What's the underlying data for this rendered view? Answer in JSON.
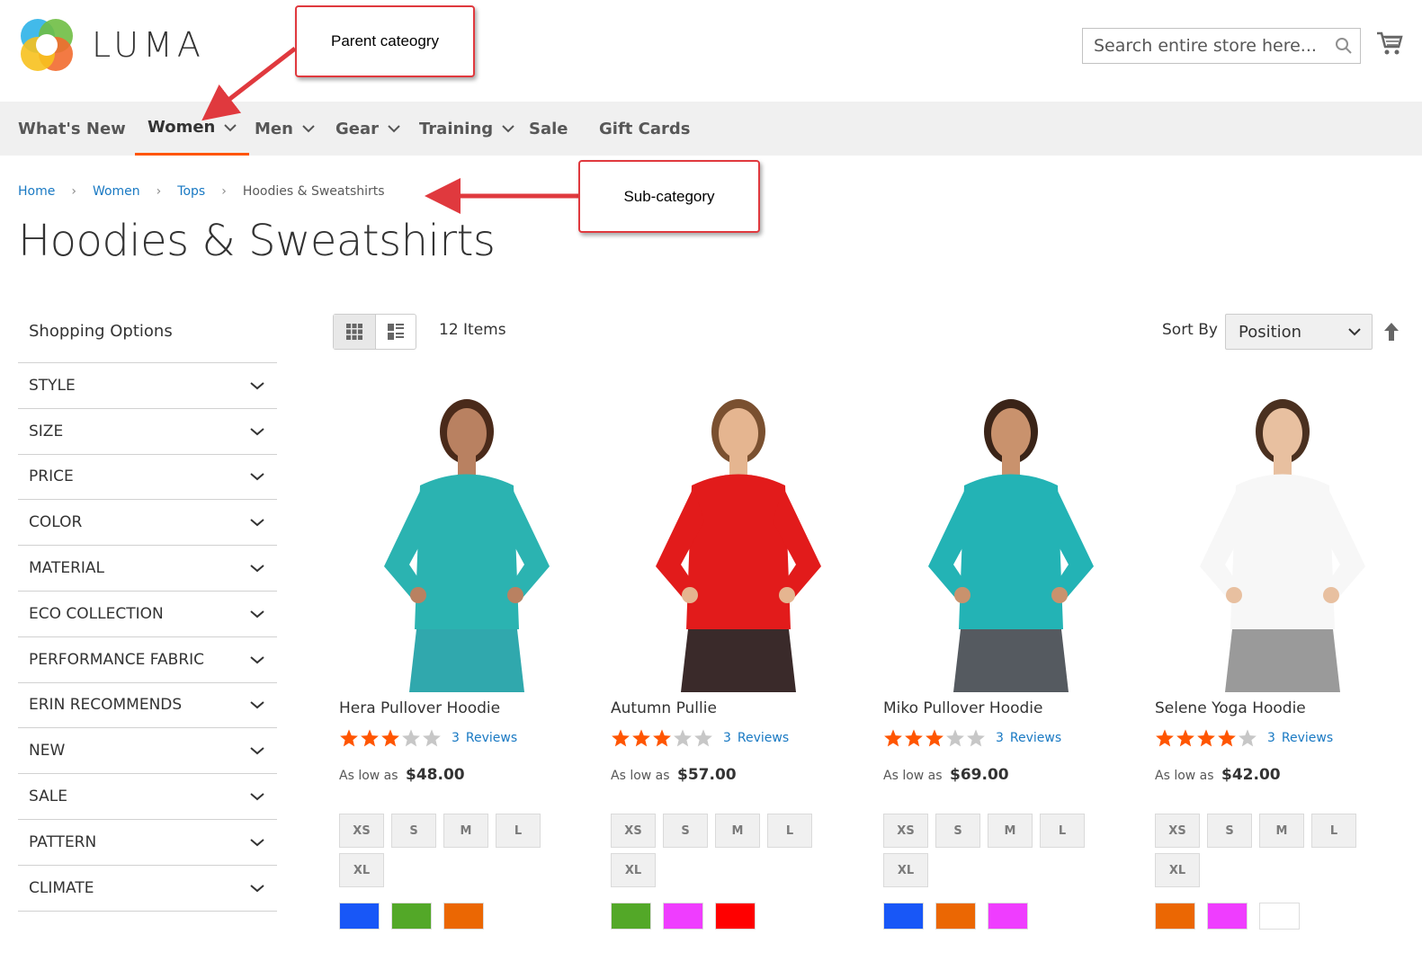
{
  "header": {
    "logo_text": "LUMA",
    "search_placeholder": "Search entire store here...",
    "icons": [
      "search-icon",
      "cart-icon"
    ]
  },
  "nav": {
    "items": [
      {
        "label": "What's New"
      },
      {
        "label": "Women"
      },
      {
        "label": "Men"
      },
      {
        "label": "Gear"
      },
      {
        "label": "Training"
      },
      {
        "label": "Sale"
      },
      {
        "label": "Gift Cards"
      }
    ],
    "active": "Women"
  },
  "breadcrumb": [
    "Home",
    "Women",
    "Tops",
    "Hoodies & Sweatshirts"
  ],
  "page_title": "Hoodies & Sweatshirts",
  "annotations": {
    "parent": "Parent cateogry",
    "sub": "Sub-category"
  },
  "sidebar": {
    "title": "Shopping Options",
    "filters": [
      "STYLE",
      "SIZE",
      "PRICE",
      "COLOR",
      "MATERIAL",
      "ECO COLLECTION",
      "PERFORMANCE FABRIC",
      "ERIN RECOMMENDS",
      "NEW",
      "SALE",
      "PATTERN",
      "CLIMATE"
    ]
  },
  "toolbar": {
    "item_count": "12 Items",
    "sort_label": "Sort By",
    "sort_value": "Position"
  },
  "products": [
    {
      "name": "Hera Pullover Hoodie",
      "rating": 3,
      "review_count": "3",
      "review_label": "Reviews",
      "price_prefix": "As low as",
      "price": "$48.00",
      "sizes": [
        "XS",
        "S",
        "M",
        "L",
        "XL"
      ],
      "colors": [
        "#1857f7",
        "#53a828",
        "#eb6703"
      ]
    },
    {
      "name": "Autumn Pullie",
      "rating": 3,
      "review_count": "3",
      "review_label": "Reviews",
      "price_prefix": "As low as",
      "price": "$57.00",
      "sizes": [
        "XS",
        "S",
        "M",
        "L",
        "XL"
      ],
      "colors": [
        "#53a828",
        "#ef3dff",
        "#ff0000"
      ]
    },
    {
      "name": "Miko Pullover Hoodie",
      "rating": 3,
      "review_count": "3",
      "review_label": "Reviews",
      "price_prefix": "As low as",
      "price": "$69.00",
      "sizes": [
        "XS",
        "S",
        "M",
        "L",
        "XL"
      ],
      "colors": [
        "#1857f7",
        "#eb6703",
        "#ef3dff"
      ]
    },
    {
      "name": "Selene Yoga Hoodie",
      "rating": 4,
      "review_count": "3",
      "review_label": "Reviews",
      "price_prefix": "As low as",
      "price": "$42.00",
      "sizes": [
        "XS",
        "S",
        "M",
        "L",
        "XL"
      ],
      "colors": [
        "#eb6703",
        "#ef3dff",
        "#ffffff"
      ]
    }
  ],
  "colors": {
    "accent": "#ff5501",
    "link": "#1979c3",
    "star": "#ff5501",
    "nav_bg": "#f0f0f0",
    "annotation": "#e0393e"
  }
}
